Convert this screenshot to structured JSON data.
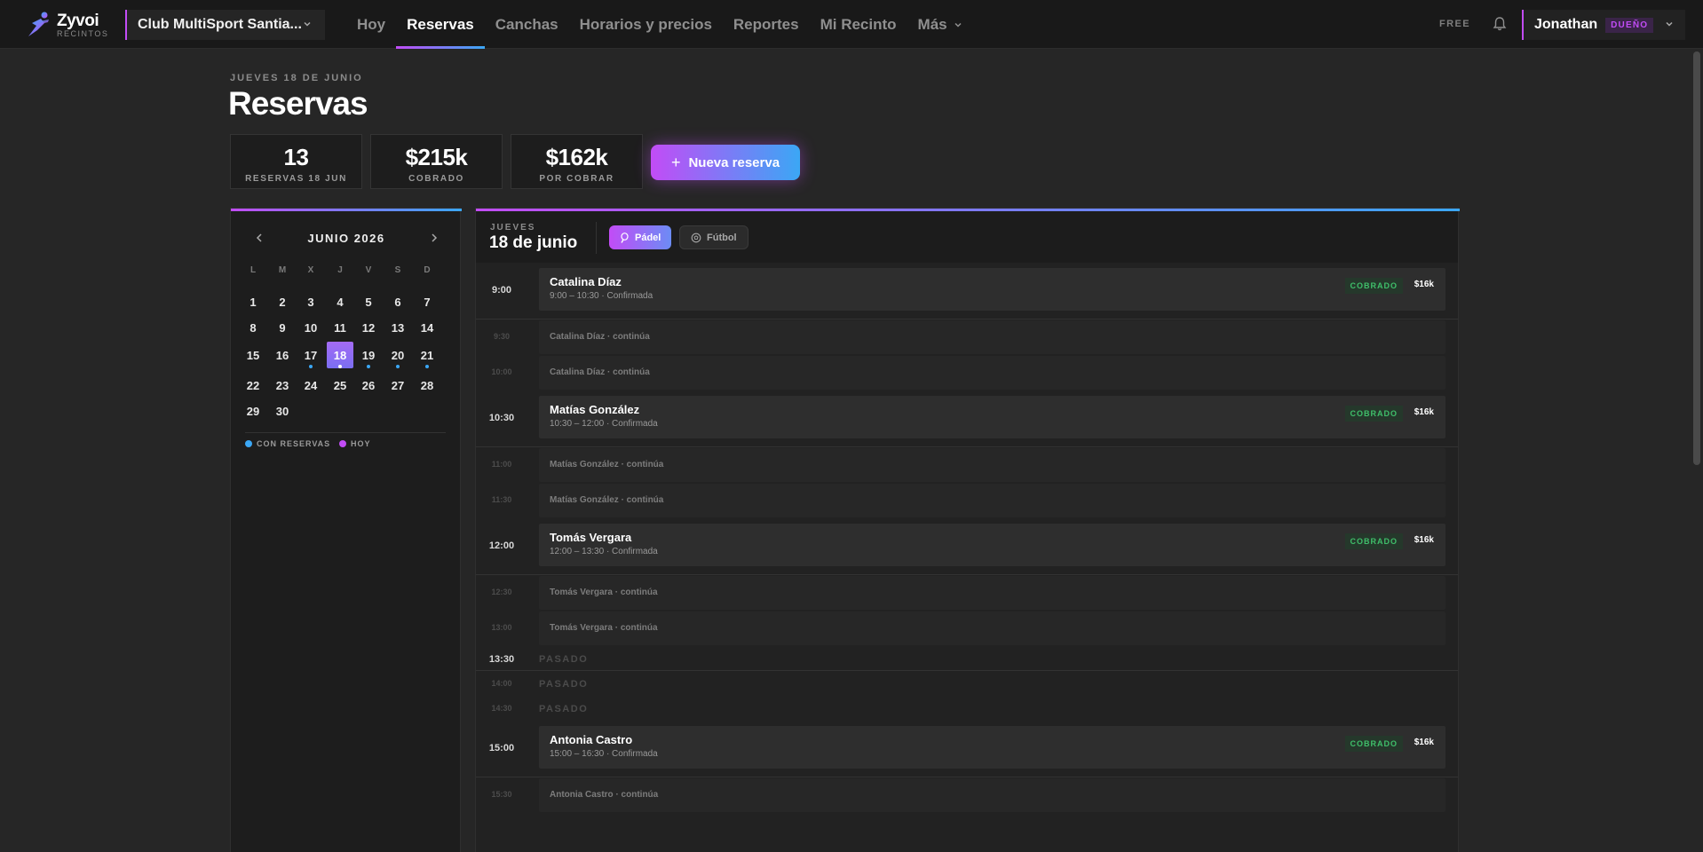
{
  "app": {
    "name": "Zyvoi",
    "sub": "RECINTOS",
    "venue": "Club MultiSport Santia..."
  },
  "nav": [
    {
      "label": "Hoy",
      "active": false
    },
    {
      "label": "Reservas",
      "active": true
    },
    {
      "label": "Canchas",
      "active": false
    },
    {
      "label": "Horarios y precios",
      "active": false
    },
    {
      "label": "Reportes",
      "active": false
    },
    {
      "label": "Mi Recinto",
      "active": false
    },
    {
      "label": "Más",
      "active": false
    }
  ],
  "plan": "FREE",
  "user": {
    "name": "Jonathan",
    "role": "DUEÑO"
  },
  "header": {
    "eyebrow": "JUEVES 18 DE JUNIO",
    "title": "Reservas"
  },
  "stats": [
    {
      "value": "13",
      "label": "RESERVAS 18 JUN"
    },
    {
      "value": "$215k",
      "label": "COBRADO"
    },
    {
      "value": "$162k",
      "label": "POR COBRAR"
    }
  ],
  "new_booking": {
    "plus": "+",
    "label": "Nueva reserva"
  },
  "calendar": {
    "month": "JUNIO 2026",
    "dow": [
      "L",
      "M",
      "X",
      "J",
      "V",
      "S",
      "D"
    ],
    "today": 18,
    "with_bookings": [
      17,
      18,
      19,
      20,
      21
    ],
    "legend": {
      "bookings": "CON RESERVAS",
      "today": "HOY"
    }
  },
  "schedule": {
    "eyebrow": "JUEVES",
    "date": "18 de junio",
    "filters": [
      {
        "label": "Pádel",
        "active": true,
        "icon": "padel-icon"
      },
      {
        "label": "Fútbol",
        "active": false,
        "icon": "soccer-ball-icon"
      }
    ],
    "slots": [
      {
        "time": "9:00",
        "kind": "booking",
        "name": "Catalina Díaz",
        "sub": "9:00 – 10:30 · Confirmada",
        "status": "COBRADO",
        "price": "$16k"
      },
      {
        "time": "9:30",
        "kind": "cont",
        "text": "Catalina Díaz · continúa"
      },
      {
        "time": "10:00",
        "kind": "cont",
        "text": "Catalina Díaz · continúa"
      },
      {
        "time": "10:30",
        "kind": "booking",
        "name": "Matías González",
        "sub": "10:30 – 12:00 · Confirmada",
        "status": "COBRADO",
        "price": "$16k"
      },
      {
        "time": "11:00",
        "kind": "cont",
        "text": "Matías González · continúa"
      },
      {
        "time": "11:30",
        "kind": "cont",
        "text": "Matías González · continúa"
      },
      {
        "time": "12:00",
        "kind": "booking",
        "name": "Tomás Vergara",
        "sub": "12:00 – 13:30 · Confirmada",
        "status": "COBRADO",
        "price": "$16k"
      },
      {
        "time": "12:30",
        "kind": "cont",
        "text": "Tomás Vergara · continúa"
      },
      {
        "time": "13:00",
        "kind": "cont",
        "text": "Tomás Vergara · continúa"
      },
      {
        "time": "13:30",
        "kind": "past",
        "text": "PASADO"
      },
      {
        "time": "14:00",
        "kind": "past",
        "text": "PASADO"
      },
      {
        "time": "14:30",
        "kind": "past",
        "text": "PASADO"
      },
      {
        "time": "15:00",
        "kind": "booking",
        "name": "Antonia Castro",
        "sub": "15:00 – 16:30 · Confirmada",
        "status": "COBRADO",
        "price": "$16k"
      },
      {
        "time": "15:30",
        "kind": "cont",
        "text": "Antonia Castro · continúa"
      }
    ]
  }
}
